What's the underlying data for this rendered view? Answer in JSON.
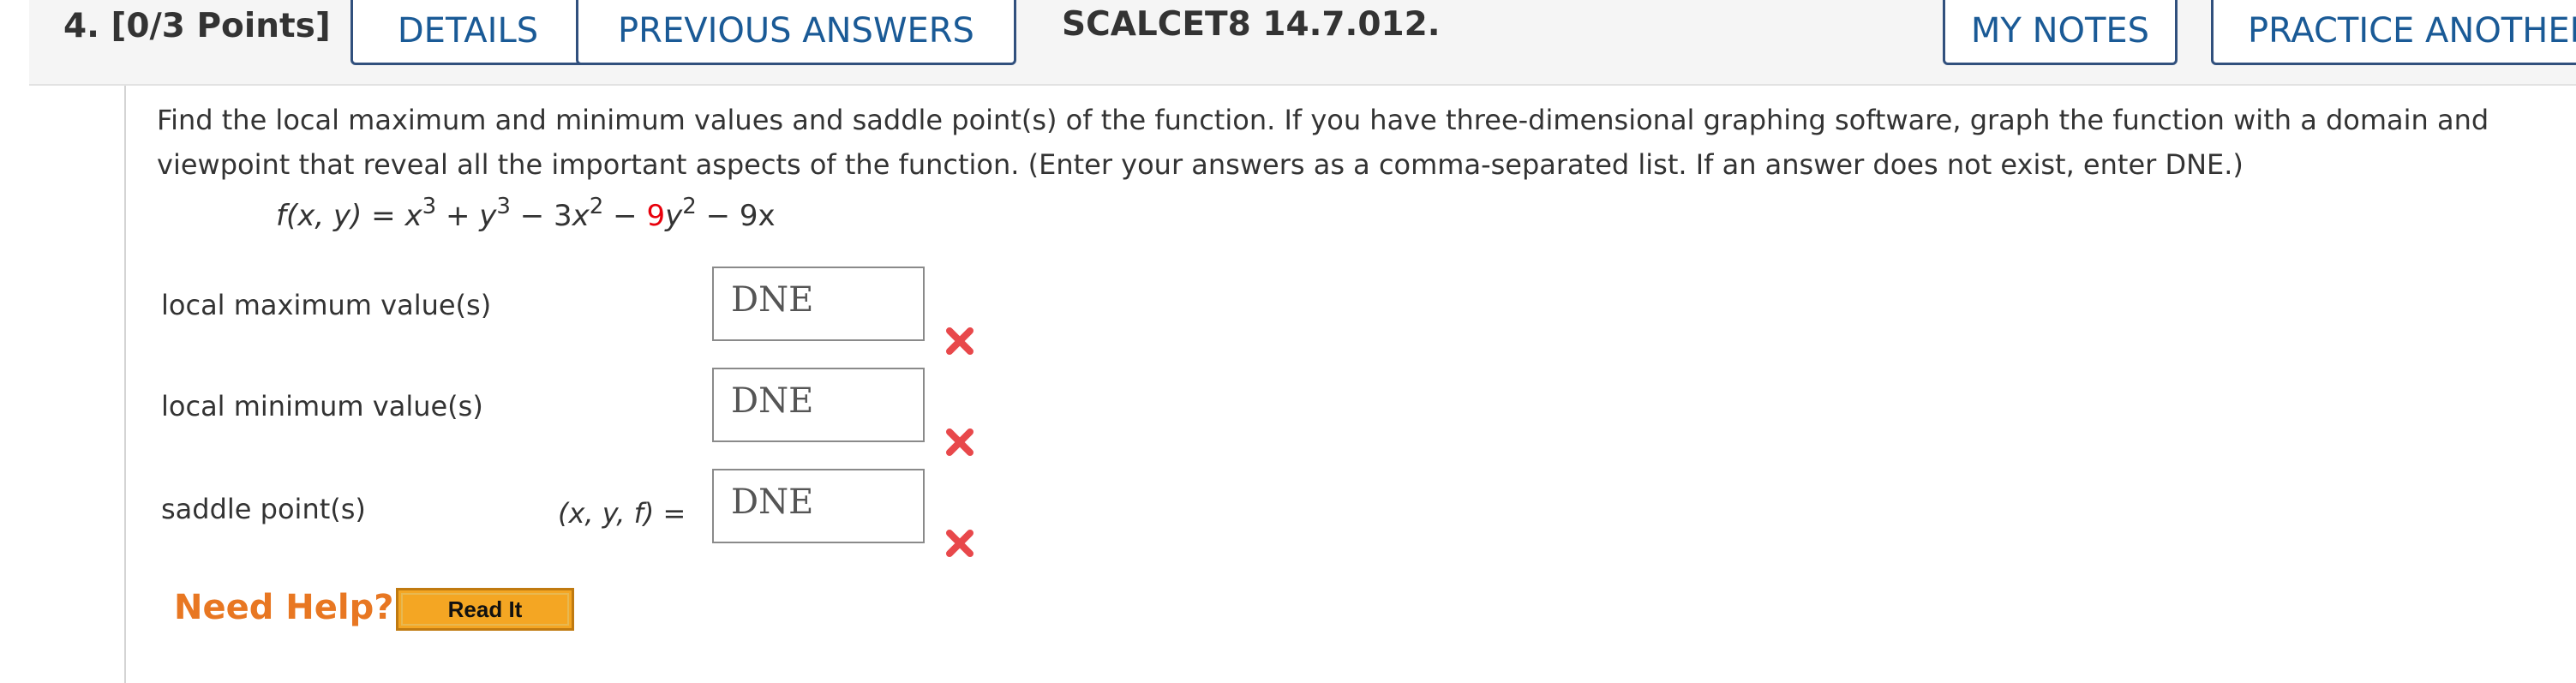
{
  "header": {
    "question_number": "4.",
    "points": "[0/3 Points]",
    "details_label": "DETAILS",
    "previous_answers_label": "PREVIOUS ANSWERS",
    "course_code": "SCALCET8 14.7.012.",
    "my_notes_label": "MY NOTES",
    "practice_another_label": "PRACTICE ANOTHER"
  },
  "question": {
    "text": "Find the local maximum and minimum values and saddle point(s) of the function. If you have three-dimensional graphing software, graph the function with a domain and viewpoint that reveal all the important aspects of the function. (Enter your answers as a comma-separated list. If an answer does not exist, enter DNE.)",
    "formula": {
      "lhs": "f(x, y)",
      "equals": " = ",
      "t1": "x",
      "t1_exp": "3",
      "op1": " + ",
      "t2": "y",
      "t2_exp": "3",
      "op2": " − ",
      "t3_coef": "3",
      "t3": "x",
      "t3_exp": "2",
      "op3": " − ",
      "t4_coef": "9",
      "t4": "y",
      "t4_exp": "2",
      "op4": " − ",
      "t5": "9x"
    }
  },
  "answers": [
    {
      "label": "local maximum value(s)",
      "value": "DNE",
      "status": "incorrect"
    },
    {
      "label": "local minimum value(s)",
      "value": "DNE",
      "status": "incorrect"
    },
    {
      "label": "saddle point(s)",
      "prefix": "(x, y, f) =",
      "value": "DNE",
      "status": "incorrect"
    }
  ],
  "help": {
    "label": "Need Help?",
    "read_it_label": "Read It"
  },
  "colors": {
    "header_bg": "#f5f5f5",
    "tab_text": "#1a5a96",
    "tab_border": "#31507d",
    "highlight_red": "#e8000b",
    "incorrect_x": "#e8484b",
    "help_orange": "#e87722",
    "read_it_bg": "#f4a623"
  },
  "icons": {
    "incorrect": "x-mark-icon"
  }
}
